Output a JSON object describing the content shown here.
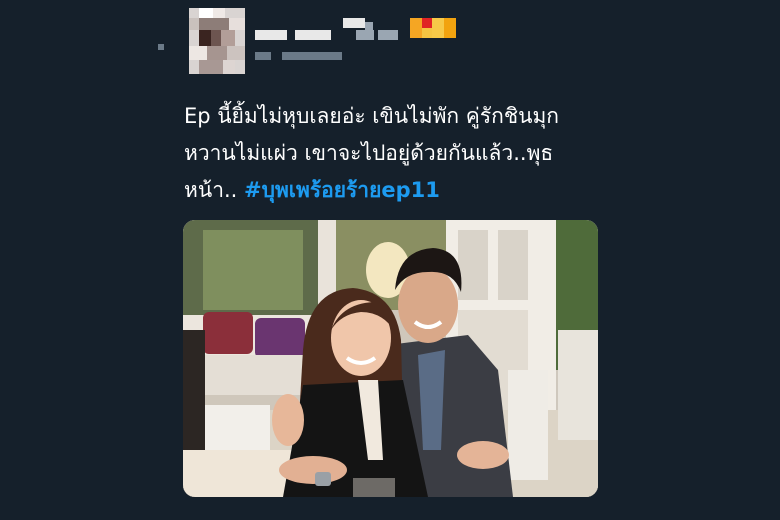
{
  "tweet": {
    "text_lines": [
      "Ep  นี้ยิ้มไม่หุบเลยอ่ะ เขินไม่พัก คู่รักชินมุก",
      "หวานไม่แผ่ว เขาจะไปอยู่ด้วยกันแล้ว..พุธ",
      "หน้า.. "
    ],
    "hashtag": "#บุพเพร้อยร้ายep11"
  },
  "media": {
    "description_icon": "photo"
  },
  "colors": {
    "background": "#15202b",
    "text": "#ffffff",
    "hashtag": "#1d9bf0"
  }
}
